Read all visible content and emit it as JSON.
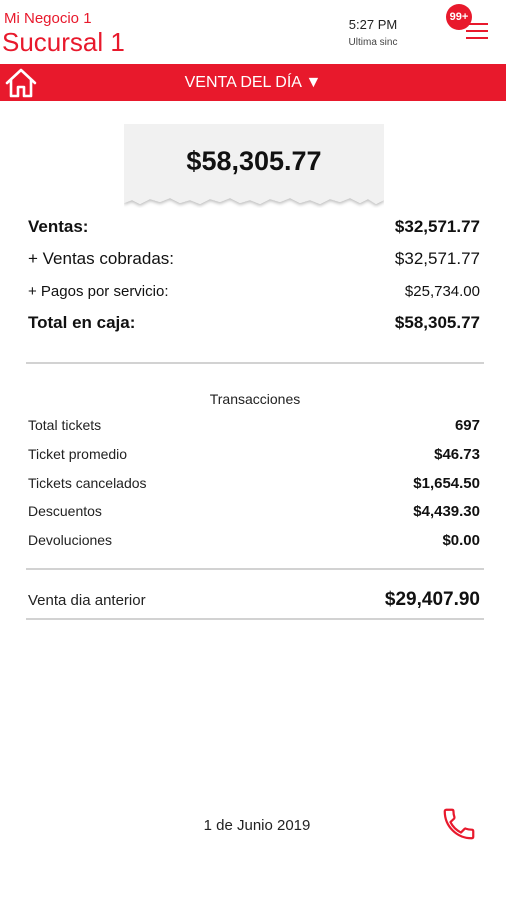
{
  "header": {
    "business_name": "Mi Negocio 1",
    "branch_name": "Sucursal 1",
    "sync_time": "5:27 PM",
    "sync_label": "Ultima sinc",
    "notification_count": "99+"
  },
  "toolbar": {
    "period_label": "VENTA DEL DÍA ▼"
  },
  "summary": {
    "total_amount": "$58,305.77",
    "rows": [
      {
        "label": "Ventas:",
        "value": "$32,571.77"
      },
      {
        "label": "+ Ventas cobradas:",
        "value": "$32,571.77"
      },
      {
        "label": "+ Pagos por servicio:",
        "value": "$25,734.00"
      },
      {
        "label": "Total en caja:",
        "value": "$58,305.77"
      }
    ]
  },
  "transactions": {
    "title": "Transacciones",
    "rows": [
      {
        "label": "Total tickets",
        "value": "697"
      },
      {
        "label": "Ticket promedio",
        "value": "$46.73"
      },
      {
        "label": "Tickets cancelados",
        "value": "$1,654.50"
      },
      {
        "label": "Descuentos",
        "value": "$4,439.30"
      },
      {
        "label": "Devoluciones",
        "value": "$0.00"
      }
    ]
  },
  "previous": {
    "label": "Venta dia anterior",
    "value": "$29,407.90"
  },
  "footer": {
    "date": "1 de Junio 2019"
  },
  "icons": {
    "home": "home-icon",
    "menu": "hamburger-menu-icon",
    "phone": "phone-icon"
  },
  "colors": {
    "accent": "#e8192c"
  }
}
